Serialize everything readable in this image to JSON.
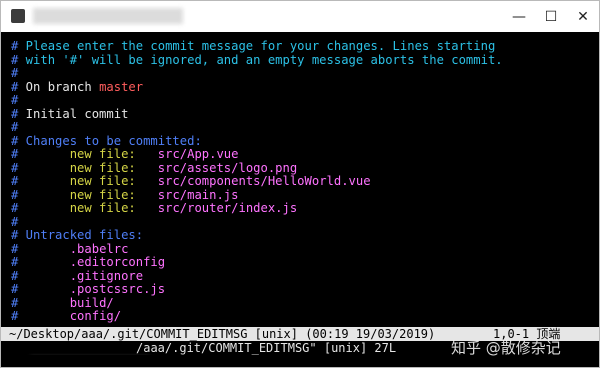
{
  "window": {
    "title": "",
    "controls": {
      "minimize": "—",
      "maximize": "☐",
      "close": "✕"
    }
  },
  "editor": {
    "lines": [
      {
        "hash": "#",
        "text": " Please enter the commit message for your changes. Lines starting",
        "kind": "comment"
      },
      {
        "hash": "#",
        "text": " with '#' will be ignored, and an empty message aborts the commit.",
        "kind": "comment"
      },
      {
        "hash": "#",
        "text": "",
        "kind": "blank"
      },
      {
        "hash": "#",
        "text": " On branch ",
        "extra": "master",
        "kind": "branch"
      },
      {
        "hash": "#",
        "text": "",
        "kind": "blank"
      },
      {
        "hash": "#",
        "text": " Initial commit",
        "kind": "plain"
      },
      {
        "hash": "#",
        "text": "",
        "kind": "blank"
      },
      {
        "hash": "#",
        "text": " Changes to be committed:",
        "kind": "header"
      },
      {
        "hash": "#",
        "label": "       new file:   ",
        "file": "src/App.vue",
        "kind": "file"
      },
      {
        "hash": "#",
        "label": "       new file:   ",
        "file": "src/assets/logo.png",
        "kind": "file"
      },
      {
        "hash": "#",
        "label": "       new file:   ",
        "file": "src/components/HelloWorld.vue",
        "kind": "file"
      },
      {
        "hash": "#",
        "label": "       new file:   ",
        "file": "src/main.js",
        "kind": "file"
      },
      {
        "hash": "#",
        "label": "       new file:   ",
        "file": "src/router/index.js",
        "kind": "file"
      },
      {
        "hash": "#",
        "text": "",
        "kind": "blank"
      },
      {
        "hash": "#",
        "text": " Untracked files:",
        "kind": "header"
      },
      {
        "hash": "#",
        "label": "       ",
        "file": ".babelrc",
        "kind": "file"
      },
      {
        "hash": "#",
        "label": "       ",
        "file": ".editorconfig",
        "kind": "file"
      },
      {
        "hash": "#",
        "label": "       ",
        "file": ".gitignore",
        "kind": "file"
      },
      {
        "hash": "#",
        "label": "       ",
        "file": ".postcssrc.js",
        "kind": "file"
      },
      {
        "hash": "#",
        "label": "       ",
        "file": "build/",
        "kind": "file"
      },
      {
        "hash": "#",
        "label": "       ",
        "file": "config/",
        "kind": "file"
      }
    ]
  },
  "status": {
    "left": "~/Desktop/aaa/.git/COMMIT_EDITMSG [unix] (00:19 19/03/2019)",
    "right": "1,0-1 顶端"
  },
  "message": {
    "text": "/aaa/.git/COMMIT_EDITMSG\" [unix] 27L"
  },
  "watermark": "知乎 @散修杂记",
  "colors": {
    "background": "#000000",
    "comment": "#2cc1e6",
    "branch": "#ff5d5d",
    "header": "#4f7ff7",
    "label": "#d5d546",
    "file": "#ff73ff"
  }
}
